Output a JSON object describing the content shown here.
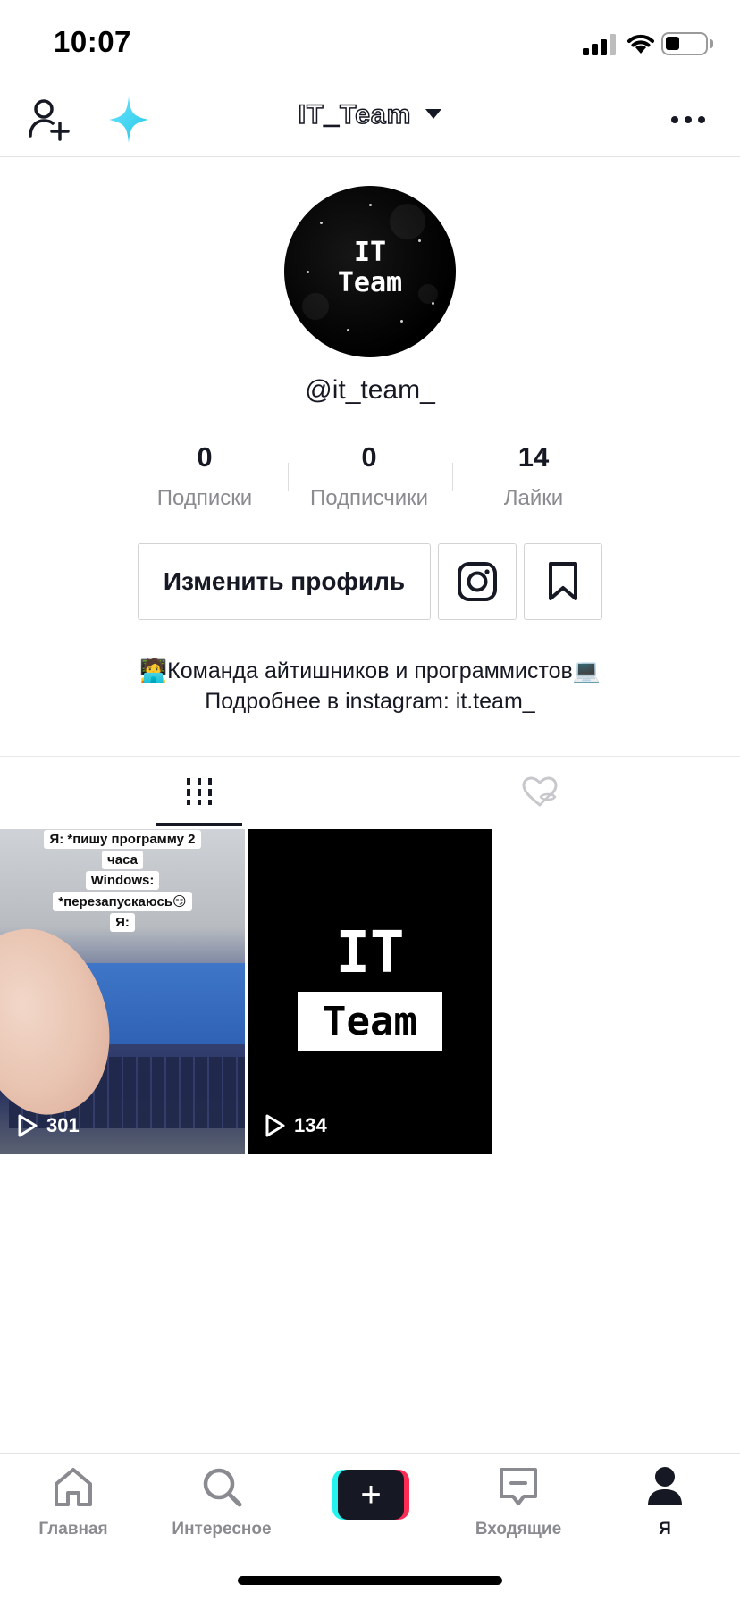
{
  "status_bar": {
    "time": "10:07"
  },
  "header": {
    "title": "IT_Team"
  },
  "profile": {
    "avatar_line1": "IT",
    "avatar_line2": "Team",
    "handle": "@it_team_",
    "stats": [
      {
        "value": "0",
        "label": "Подписки"
      },
      {
        "value": "0",
        "label": "Подписчики"
      },
      {
        "value": "14",
        "label": "Лайки"
      }
    ],
    "edit_button_label": "Изменить профиль",
    "bio_line1": "🧑‍💻Команда айтишников и программистов💻",
    "bio_line2": "Подробнее в instagram: it.team_"
  },
  "videos": [
    {
      "caption_lines": [
        "Я: *пишу программу 2",
        "часа",
        "Windows:",
        "*перезапускаюсь😏",
        "Я:"
      ],
      "views": "301"
    },
    {
      "logo_line1": "IT",
      "logo_line2": "Team",
      "views": "134"
    }
  ],
  "bottom_nav": [
    {
      "label": "Главная",
      "icon": "home-icon"
    },
    {
      "label": "Интересное",
      "icon": "search-icon"
    },
    {
      "label": "",
      "icon": "plus-icon"
    },
    {
      "label": "Входящие",
      "icon": "inbox-icon"
    },
    {
      "label": "Я",
      "icon": "profile-icon"
    }
  ]
}
